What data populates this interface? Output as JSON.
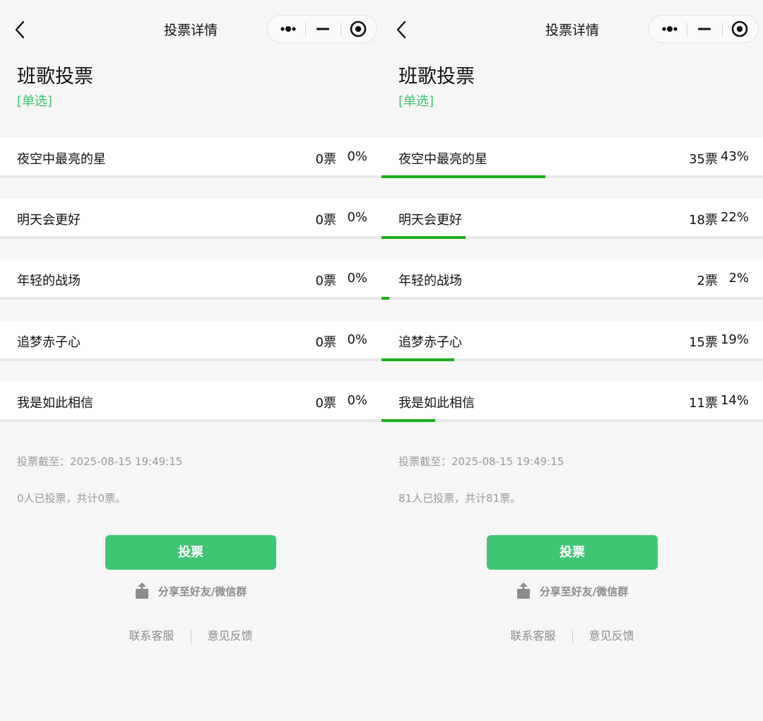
{
  "panels": [
    {
      "nav_title": "投票详情",
      "vote_title": "班歌投票",
      "vote_type": "[单选]",
      "options": [
        {
          "label": "夜空中最亮的星",
          "votes": "0票",
          "percent": "0%",
          "ratio": 0
        },
        {
          "label": "明天会更好",
          "votes": "0票",
          "percent": "0%",
          "ratio": 0
        },
        {
          "label": "年轻的战场",
          "votes": "0票",
          "percent": "0%",
          "ratio": 0
        },
        {
          "label": "追梦赤子心",
          "votes": "0票",
          "percent": "0%",
          "ratio": 0
        },
        {
          "label": "我是如此相信",
          "votes": "0票",
          "percent": "0%",
          "ratio": 0
        }
      ],
      "deadline": "投票截至：2025-08-15 19:49:15",
      "summary": "0人已投票，共计0票。",
      "vote_button": "投票",
      "share_text": "分享至好友/微信群",
      "footer": {
        "contact": "联系客服",
        "feedback": "意见反馈"
      }
    },
    {
      "nav_title": "投票详情",
      "vote_title": "班歌投票",
      "vote_type": "[单选]",
      "options": [
        {
          "label": "夜空中最亮的星",
          "votes": "35票",
          "percent": "43%",
          "ratio": 0.43
        },
        {
          "label": "明天会更好",
          "votes": "18票",
          "percent": "22%",
          "ratio": 0.22
        },
        {
          "label": "年轻的战场",
          "votes": "2票",
          "percent": "2%",
          "ratio": 0.02
        },
        {
          "label": "追梦赤子心",
          "votes": "15票",
          "percent": "19%",
          "ratio": 0.19
        },
        {
          "label": "我是如此相信",
          "votes": "11票",
          "percent": "14%",
          "ratio": 0.14
        }
      ],
      "deadline": "投票截至：2025-08-15 19:49:15",
      "summary": "81人已投票，共计81票。",
      "vote_button": "投票",
      "share_text": "分享至好友/微信群",
      "footer": {
        "contact": "联系客服",
        "feedback": "意见反馈"
      }
    }
  ],
  "colors": {
    "accent": "#3fc672",
    "progress": "#1aad19",
    "muted": "#9a9a9a"
  },
  "icons": {
    "back": "chevron-left-icon",
    "more": "more-dots-icon",
    "minimize": "minimize-icon",
    "close": "target-close-icon",
    "share": "share-icon"
  }
}
